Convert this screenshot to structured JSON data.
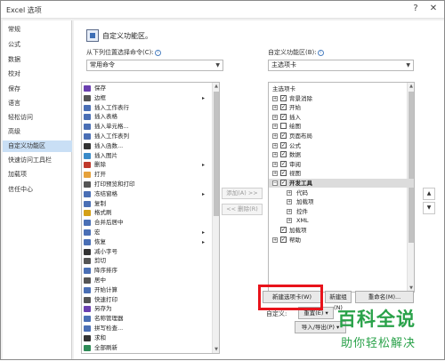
{
  "window": {
    "title": "Excel 选项",
    "help": "?",
    "close": "✕"
  },
  "sidebar": {
    "items": [
      "常规",
      "公式",
      "数据",
      "校对",
      "保存",
      "语言",
      "轻松访问",
      "高级",
      "自定义功能区",
      "快速访问工具栏",
      "加载项",
      "信任中心"
    ],
    "selected_index": 8
  },
  "header": {
    "text": "自定义功能区。"
  },
  "left": {
    "label": "从下列位置选择命令(C):",
    "selected": "常用命令",
    "commands": [
      {
        "label": "保存",
        "icon": "save-icon",
        "color": "#6a3fb0"
      },
      {
        "label": "边框",
        "icon": "border-icon",
        "color": "#555555",
        "sub": "▸"
      },
      {
        "label": "插入工作表行",
        "icon": "insert-row-icon",
        "color": "#4a6fb5"
      },
      {
        "label": "插入表格",
        "icon": "table-icon",
        "color": "#4a6fb5"
      },
      {
        "label": "插入单元格...",
        "icon": "insert-cells-icon",
        "color": "#4a6fb5"
      },
      {
        "label": "插入工作表列",
        "icon": "insert-column-icon",
        "color": "#4a6fb5"
      },
      {
        "label": "插入函数...",
        "icon": "function-icon",
        "color": "#333333"
      },
      {
        "label": "插入图片",
        "icon": "picture-icon",
        "color": "#3a8bc9"
      },
      {
        "label": "删除",
        "icon": "delete-icon",
        "color": "#c0392b",
        "sub": "▸"
      },
      {
        "label": "打开",
        "icon": "open-icon",
        "color": "#e6a23c"
      },
      {
        "label": "打印预览和打印",
        "icon": "print-preview-icon",
        "color": "#555555"
      },
      {
        "label": "冻结窗格",
        "icon": "freeze-panes-icon",
        "color": "#4a6fb5",
        "sub": "▸"
      },
      {
        "label": "复制",
        "icon": "copy-icon",
        "color": "#4a6fb5"
      },
      {
        "label": "格式刷",
        "icon": "format-painter-icon",
        "color": "#d4a017"
      },
      {
        "label": "合并后居中",
        "icon": "merge-center-icon",
        "color": "#4a6fb5"
      },
      {
        "label": "宏",
        "icon": "macro-icon",
        "color": "#4a6fb5",
        "sub": "▸"
      },
      {
        "label": "恢复",
        "icon": "redo-icon",
        "color": "#4a6fb5",
        "sub": "▸"
      },
      {
        "label": "减小字号",
        "icon": "decrease-font-icon",
        "color": "#333333"
      },
      {
        "label": "剪切",
        "icon": "cut-icon",
        "color": "#555555"
      },
      {
        "label": "降序排序",
        "icon": "sort-desc-icon",
        "color": "#4a6fb5"
      },
      {
        "label": "居中",
        "icon": "center-icon",
        "color": "#555555"
      },
      {
        "label": "开始计算",
        "icon": "calculate-icon",
        "color": "#4a6fb5"
      },
      {
        "label": "快速打印",
        "icon": "quick-print-icon",
        "color": "#555555"
      },
      {
        "label": "另存为",
        "icon": "save-as-icon",
        "color": "#6a3fb0"
      },
      {
        "label": "名称管理器",
        "icon": "name-manager-icon",
        "color": "#4a6fb5"
      },
      {
        "label": "拼写检查...",
        "icon": "spelling-icon",
        "color": "#4a6fb5"
      },
      {
        "label": "求和",
        "icon": "sum-icon",
        "color": "#333333"
      },
      {
        "label": "全部刷新",
        "icon": "refresh-all-icon",
        "color": "#2e8b57"
      }
    ]
  },
  "middle": {
    "add": "添加(A) >>",
    "remove": "<< 删除(R)"
  },
  "right": {
    "label": "自定义功能区(B):",
    "selected": "主选项卡",
    "tree": [
      {
        "label": "主选项卡",
        "level": 0,
        "expander": "",
        "checked": null
      },
      {
        "label": "背景消除",
        "level": 1,
        "expander": "⊞",
        "checked": true
      },
      {
        "label": "开始",
        "level": 1,
        "expander": "⊞",
        "checked": true
      },
      {
        "label": "插入",
        "level": 1,
        "expander": "⊞",
        "checked": true
      },
      {
        "label": "绘图",
        "level": 1,
        "expander": "⊞",
        "checked": false
      },
      {
        "label": "页面布局",
        "level": 1,
        "expander": "⊞",
        "checked": true
      },
      {
        "label": "公式",
        "level": 1,
        "expander": "⊞",
        "checked": true
      },
      {
        "label": "数据",
        "level": 1,
        "expander": "⊞",
        "checked": true
      },
      {
        "label": "审阅",
        "level": 1,
        "expander": "⊞",
        "checked": true
      },
      {
        "label": "视图",
        "level": 1,
        "expander": "⊞",
        "checked": true
      },
      {
        "label": "开发工具",
        "level": 1,
        "expander": "⊟",
        "checked": true,
        "selected": true
      },
      {
        "label": "代码",
        "level": 2,
        "expander": "⊞",
        "checked": null
      },
      {
        "label": "加载项",
        "level": 2,
        "expander": "⊞",
        "checked": null
      },
      {
        "label": "控件",
        "level": 2,
        "expander": "⊞",
        "checked": null
      },
      {
        "label": "XML",
        "level": 2,
        "expander": "⊞",
        "checked": null
      },
      {
        "label": "加载项",
        "level": 1,
        "expander": "",
        "checked": true
      },
      {
        "label": "帮助",
        "level": 1,
        "expander": "⊞",
        "checked": true
      }
    ],
    "up": "▲",
    "down": "▼",
    "new_tab": "新建选项卡(W)",
    "new_group": "新建组(N)",
    "rename": "重命名(M)...",
    "customize_label": "自定义:",
    "reset": "重置(E) ▾",
    "import_export": "导入/导出(P) ▾"
  },
  "watermark": {
    "top": "百科全说",
    "bottom": "助你轻松解决"
  },
  "colors": {
    "highlight": "#e8131b",
    "selection": "#c9dff5",
    "watermark": "#2aa24a"
  }
}
